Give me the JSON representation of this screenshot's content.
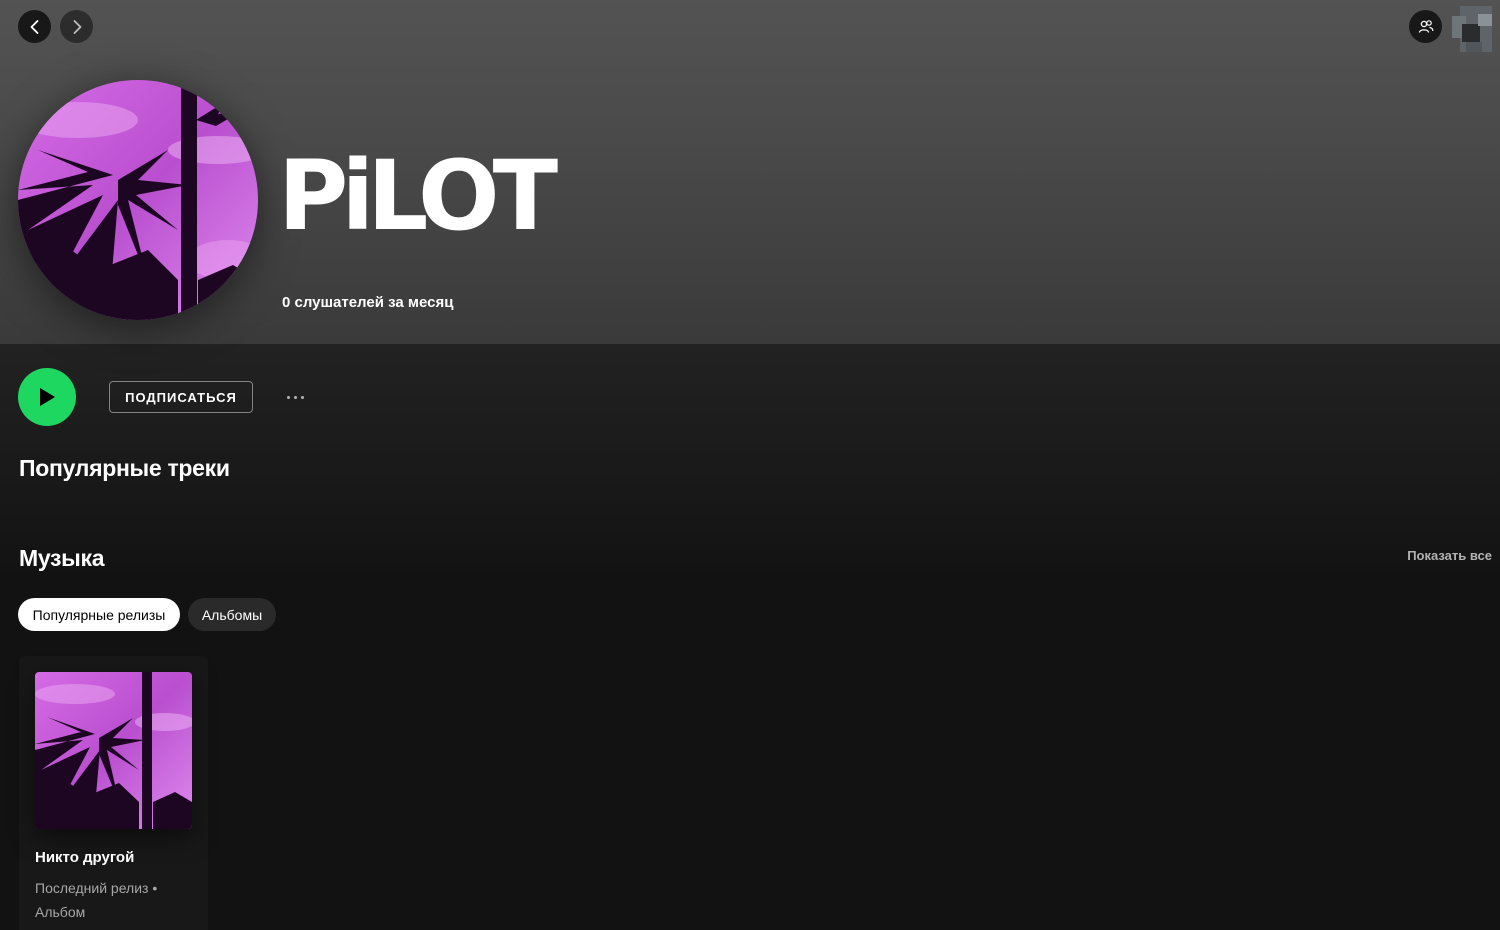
{
  "nav": {
    "back_icon": "chevron-left-icon",
    "forward_icon": "chevron-right-icon",
    "friends_icon": "friends-activity-icon"
  },
  "artist": {
    "name": "PiLOT",
    "monthly_listeners": "0 слушателей за месяц"
  },
  "actions": {
    "play_icon": "play-icon",
    "follow_label": "ПОДПИСАТЬСЯ",
    "more_icon": "more-dots-icon"
  },
  "sections": {
    "popular_tracks_title": "Популярные треки",
    "music_title": "Музыка",
    "show_all_label": "Показать все"
  },
  "filters": [
    {
      "label": "Популярные релизы",
      "active": true
    },
    {
      "label": "Альбомы",
      "active": false
    }
  ],
  "releases": [
    {
      "title": "Никто другой",
      "subtitle": "Последний релиз • Альбом"
    }
  ],
  "colors": {
    "accent": "#1ed760",
    "background": "#121212",
    "header_gradient_top": "#535353",
    "cover_magenta": "#c45ad6",
    "muted_text": "#b3b3b3"
  }
}
